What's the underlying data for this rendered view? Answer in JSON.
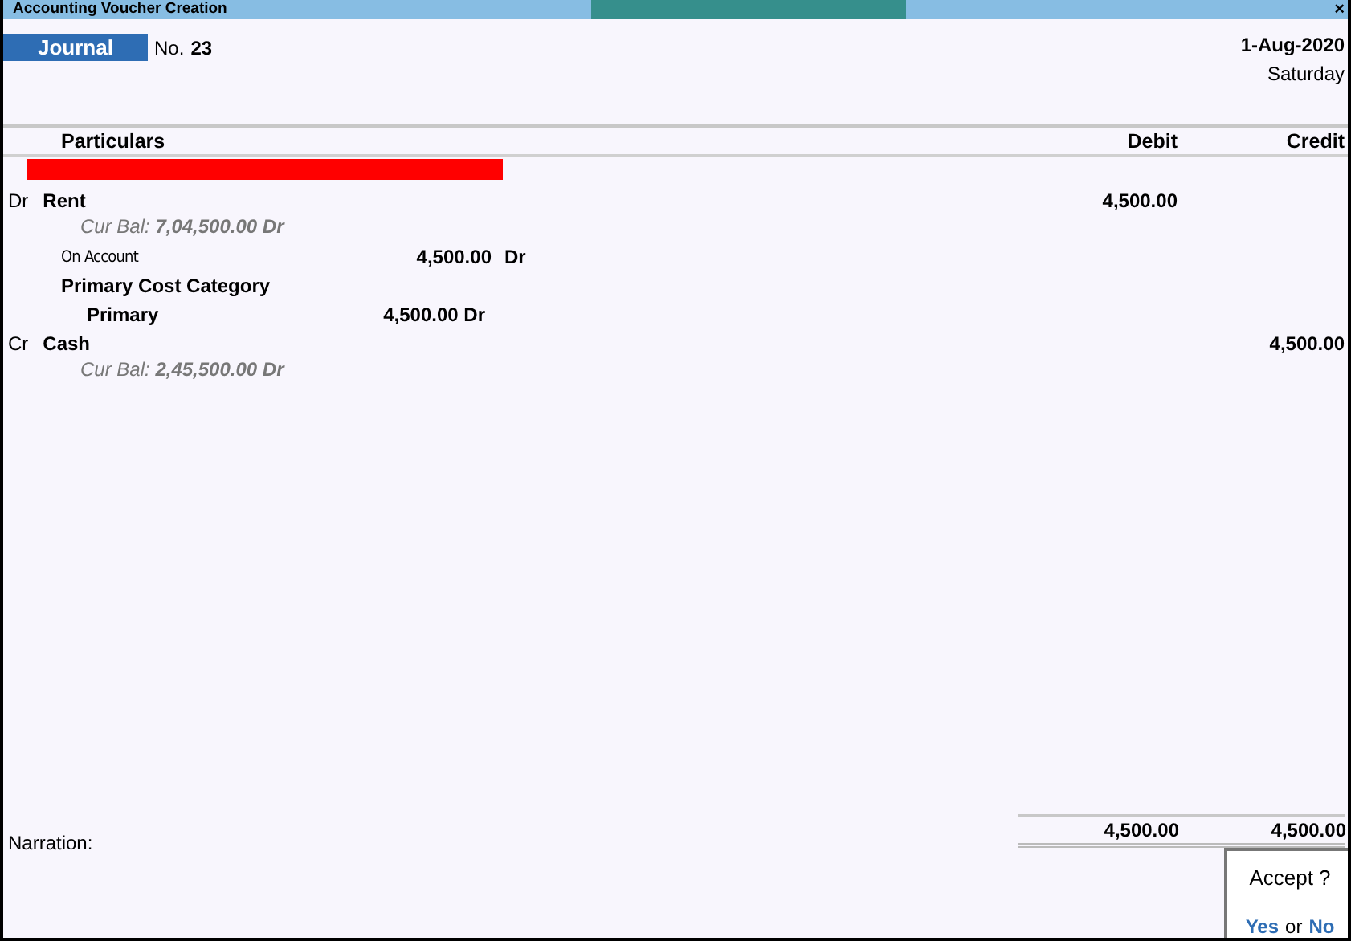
{
  "window": {
    "title": "Accounting Voucher Creation",
    "close": "×"
  },
  "voucher": {
    "type": "Journal",
    "number_label": "No.",
    "number": "23",
    "date": "1-Aug-2020",
    "day": "Saturday"
  },
  "columns": [
    "Particulars",
    "Debit",
    "Credit"
  ],
  "entries": [
    {
      "side": "Dr",
      "ledger": "Rent",
      "balance": "Cur Bal:  **7,04,500.00 Dr**",
      "debit": "4,500.00",
      "bills": [
        {
          "name": "On Account",
          "amount": "4,500.00",
          "side": "Dr"
        }
      ],
      "cost_categories": [
        {
          "name": "Primary Cost Category",
          "centres": [
            {
              "name": "Primary",
              "amount": "4,500.00 Dr"
            }
          ]
        }
      ]
    },
    {
      "side": "Cr",
      "ledger": "Cash",
      "balance": "Cur Bal:  **2,45,500.00 Dr**",
      "credit": "4,500.00"
    }
  ],
  "narration": {
    "label": "Narration:"
  },
  "totals": {
    "debit": "4,500.00",
    "credit": "4,500.00"
  },
  "dialog": {
    "question": "Accept ?",
    "yes": "Yes",
    "or": "or",
    "no": "No"
  }
}
